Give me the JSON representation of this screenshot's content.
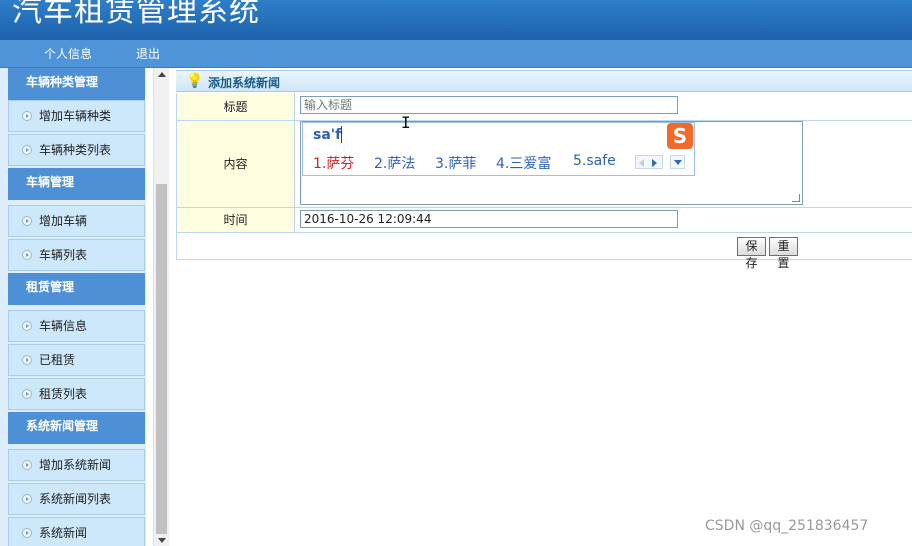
{
  "app": {
    "title": "汽车租赁管理系统"
  },
  "topnav": {
    "profile": "个人信息",
    "logout": "退出"
  },
  "sidebar": {
    "sections": [
      {
        "title": "车辆种类管理",
        "items": [
          "增加车辆种类",
          "车辆种类列表"
        ]
      },
      {
        "title": "车辆管理",
        "items": [
          "增加车辆",
          "车辆列表"
        ]
      },
      {
        "title": "租赁管理",
        "items": [
          "车辆信息",
          "已租赁",
          "租赁列表"
        ]
      },
      {
        "title": "系统新闻管理",
        "items": [
          "增加系统新闻",
          "系统新闻列表",
          "系统新闻"
        ]
      }
    ]
  },
  "panel": {
    "title": "添加系统新闻"
  },
  "form": {
    "title_label": "标题",
    "title_placeholder": "输入标题",
    "content_label": "内容",
    "time_label": "时间",
    "time_value": "2016-10-26 12:09:44",
    "save_label": "保存",
    "reset_label": "重置"
  },
  "ime": {
    "composition": "sa'f",
    "logo": "S",
    "candidates": [
      "1.萨芬",
      "2.萨法",
      "3.萨菲",
      "4.三爱富",
      "5.safe"
    ]
  },
  "watermark": "CSDN @qq_251836457",
  "colors": {
    "banner": "#1d62ab",
    "sidebar_head": "#4d90d6",
    "label_bg": "#fffde0",
    "ime_first": "#d42020",
    "ime_other": "#2b62b5"
  }
}
